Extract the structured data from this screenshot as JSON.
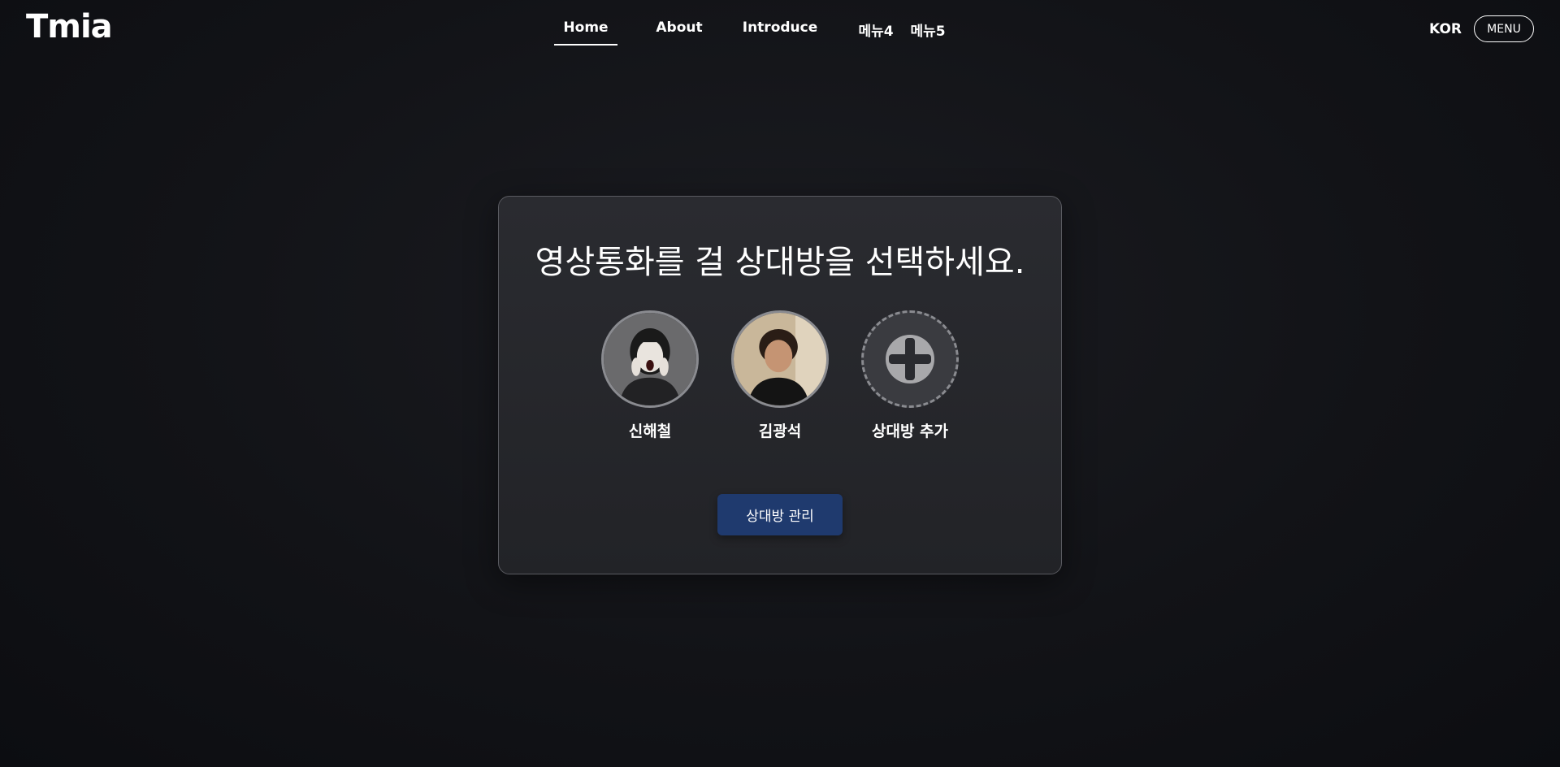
{
  "header": {
    "logo": "Tmia",
    "nav": [
      {
        "label": "Home",
        "active": true
      },
      {
        "label": "About",
        "active": false
      },
      {
        "label": "Introduce",
        "active": false
      },
      {
        "label": "메뉴4",
        "active": false
      },
      {
        "label": "메뉴5",
        "active": false
      }
    ],
    "language": "KOR",
    "menu_label": "MENU"
  },
  "card": {
    "title": "영상통화를 걸 상대방을 선택하세요.",
    "contacts": [
      {
        "name": "신해철",
        "icon": "profile-photo"
      },
      {
        "name": "김광석",
        "icon": "profile-photo"
      },
      {
        "name": "상대방 추가",
        "icon": "plus-icon"
      }
    ],
    "manage_button": "상대방 관리"
  },
  "colors": {
    "background": "#121317",
    "card": "#26272b",
    "button": "#1f3a6e",
    "accent_border": "#8a8b90"
  }
}
